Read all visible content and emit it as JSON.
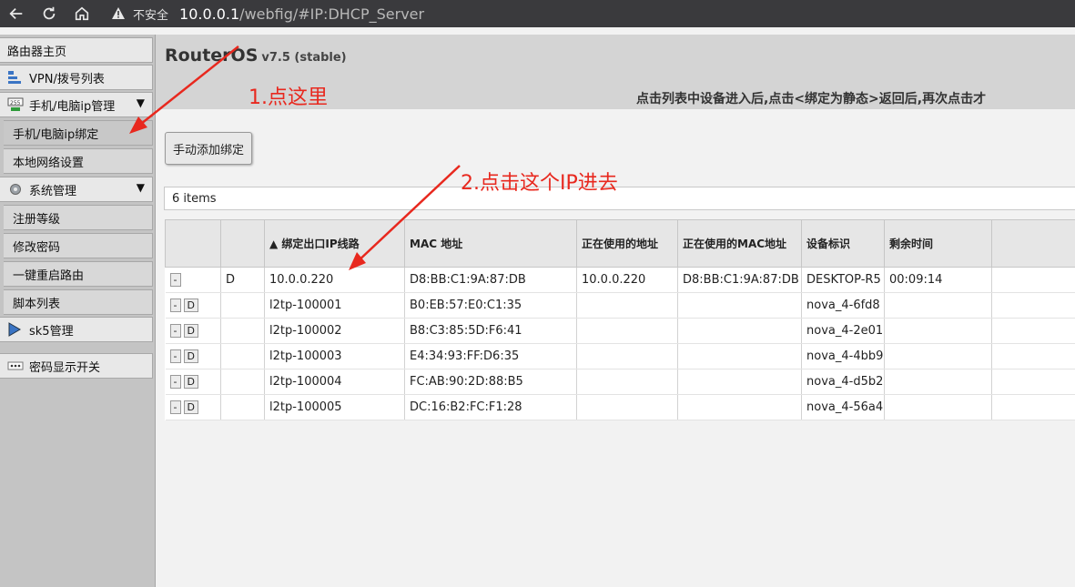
{
  "browser": {
    "insecure_label": "不安全",
    "url_host": "10.0.0.1",
    "url_path": "/webfig/#IP:DHCP_Server"
  },
  "sidebar": {
    "items": [
      {
        "label": "路由器主页"
      },
      {
        "label": "VPN/拨号列表"
      },
      {
        "label": "手机/电脑ip管理"
      },
      {
        "label": "手机/电脑ip绑定"
      },
      {
        "label": "本地网络设置"
      },
      {
        "label": "系统管理"
      },
      {
        "label": "注册等级"
      },
      {
        "label": "修改密码"
      },
      {
        "label": "一键重启路由"
      },
      {
        "label": "脚本列表"
      },
      {
        "label": "sk5管理"
      },
      {
        "label": "密码显示开关"
      }
    ],
    "caret": "▼"
  },
  "header": {
    "brand": "RouterOS",
    "version": "v7.5 (stable)",
    "tip": "点击列表中设备进入后,点击<绑定为静态>返回后,再次点击才"
  },
  "toolbar": {
    "add_button": "手动添加绑定",
    "items_count": "6 items"
  },
  "table": {
    "headers": [
      "",
      "",
      "▲ 绑定出口IP线路",
      "MAC 地址",
      "正在使用的地址",
      "正在使用的MAC地址",
      "设备标识",
      "剩余时间",
      ""
    ],
    "rows": [
      {
        "btn1": "-",
        "btn2": "",
        "flag": "D",
        "line": "10.0.0.220",
        "mac": "D8:BB:C1:9A:87:DB",
        "active_addr": "10.0.0.220",
        "active_mac": "D8:BB:C1:9A:87:DB",
        "host": "DESKTOP-R5",
        "expires": "00:09:14"
      },
      {
        "btn1": "-",
        "btn2": "D",
        "flag": "",
        "line": "l2tp-100001",
        "mac": "B0:EB:57:E0:C1:35",
        "active_addr": "",
        "active_mac": "",
        "host": "nova_4-6fd8",
        "expires": ""
      },
      {
        "btn1": "-",
        "btn2": "D",
        "flag": "",
        "line": "l2tp-100002",
        "mac": "B8:C3:85:5D:F6:41",
        "active_addr": "",
        "active_mac": "",
        "host": "nova_4-2e01",
        "expires": ""
      },
      {
        "btn1": "-",
        "btn2": "D",
        "flag": "",
        "line": "l2tp-100003",
        "mac": "E4:34:93:FF:D6:35",
        "active_addr": "",
        "active_mac": "",
        "host": "nova_4-4bb9",
        "expires": ""
      },
      {
        "btn1": "-",
        "btn2": "D",
        "flag": "",
        "line": "l2tp-100004",
        "mac": "FC:AB:90:2D:88:B5",
        "active_addr": "",
        "active_mac": "",
        "host": "nova_4-d5b2",
        "expires": ""
      },
      {
        "btn1": "-",
        "btn2": "D",
        "flag": "",
        "line": "l2tp-100005",
        "mac": "DC:16:B2:FC:F1:28",
        "active_addr": "",
        "active_mac": "",
        "host": "nova_4-56a4",
        "expires": ""
      }
    ]
  },
  "annotations": {
    "step1": "1.点这里",
    "step2": "2.点击这个IP进去",
    "color": "#e8281e"
  }
}
